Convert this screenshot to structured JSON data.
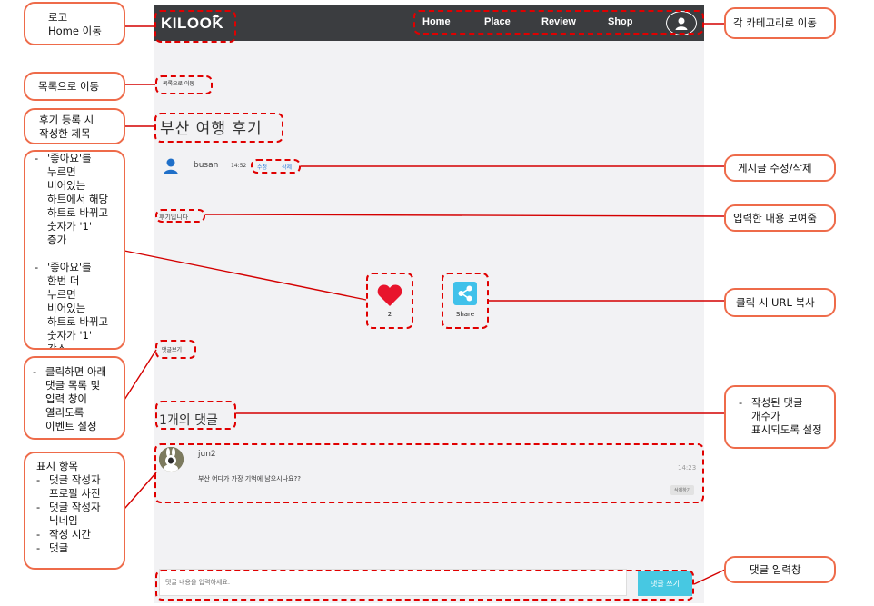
{
  "app": {
    "logo_text": "KILOOK",
    "nav_links": [
      "Home",
      "Place",
      "Review",
      "Shop"
    ],
    "back_button": "목록으로 이동",
    "post": {
      "title": "부산 여행 후기",
      "author": "busan",
      "time": "14:52",
      "edit_label": "수정",
      "delete_label": "삭제",
      "content": "후기입니다"
    },
    "like": {
      "count": "2",
      "liked": true
    },
    "share_label": "Share",
    "comments_toggle": "댓글보기",
    "comment_count_text": "1개의 댓글",
    "comment": {
      "user": "jun2",
      "time": "14:23",
      "text": "부산 어디가 가장 기억에 남으시나요??",
      "delete_label": "삭제하기"
    },
    "comment_input_placeholder": "댓글 내용을 입력하세요.",
    "comment_submit": "댓글 쓰기"
  },
  "colors": {
    "nav_bg": "#3b3d40",
    "heart": "#e8142c",
    "share": "#40c1ea",
    "link": "#2f7bd8",
    "submit": "#47c8e2",
    "annotation_dash": "#e00000",
    "annotation_border": "#ee6b4a"
  },
  "annotations": {
    "logo": [
      "로고",
      "Home 이동"
    ],
    "categories": "각 카테고리로 이동",
    "back": "목록으로 이동",
    "title": [
      "후기 등록 시",
      "작성한 제목"
    ],
    "like_bullets": [
      [
        "'좋아요'를",
        "누르면",
        "비어있는",
        "하트에서 해당",
        "하트로 바뀌고",
        "숫자가 '1'",
        "증가"
      ],
      [
        "'좋아요'를",
        "한번 더",
        "누르면",
        "비어있는",
        "하트로 바뀌고",
        "숫자가 '1'",
        "감소"
      ]
    ],
    "edit_delete": "게시글 수정/삭제",
    "content": "입력한 내용 보여줌",
    "share": "클릭 시 URL 복사",
    "toggle_bullet": [
      "클릭하면 아래",
      "댓글 목록 및",
      "입력 창이",
      "열리도록",
      "이벤트 설정"
    ],
    "count_bullet": [
      "작성된 댓글",
      "개수가",
      "표시되도록 설정"
    ],
    "display_heading": "표시 항목",
    "display_items": [
      [
        "댓글 작성자",
        "프로필 사진"
      ],
      [
        "댓글 작성자",
        "닉네임"
      ],
      [
        "작성 시간"
      ],
      [
        "댓글"
      ]
    ],
    "input": "댓글 입력창"
  }
}
